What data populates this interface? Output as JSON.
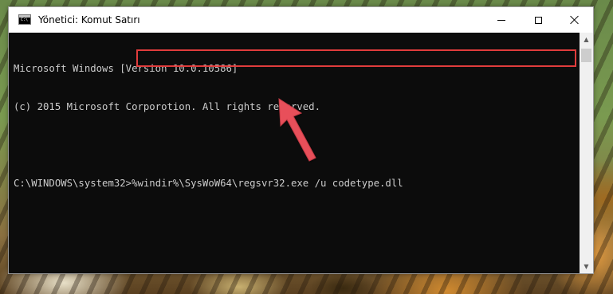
{
  "window": {
    "title": "Yönetici: Komut Satırı",
    "controls": {
      "minimize_icon": "minimize-icon",
      "maximize_icon": "maximize-icon",
      "close_icon": "close-icon"
    }
  },
  "console": {
    "lines": [
      "Microsoft Windows [Version 10.0.10586]",
      "(c) 2015 Microsoft Corporotion. All rights reserved.",
      ""
    ],
    "prompt": "C:\\WINDOWS\\system32>",
    "command": "%windir%\\SysWoW64\\regsvr32.exe /u codetype.dll"
  },
  "colors": {
    "console_bg": "#0c0c0c",
    "console_text": "#cccccc",
    "highlight": "#e03c3c"
  }
}
